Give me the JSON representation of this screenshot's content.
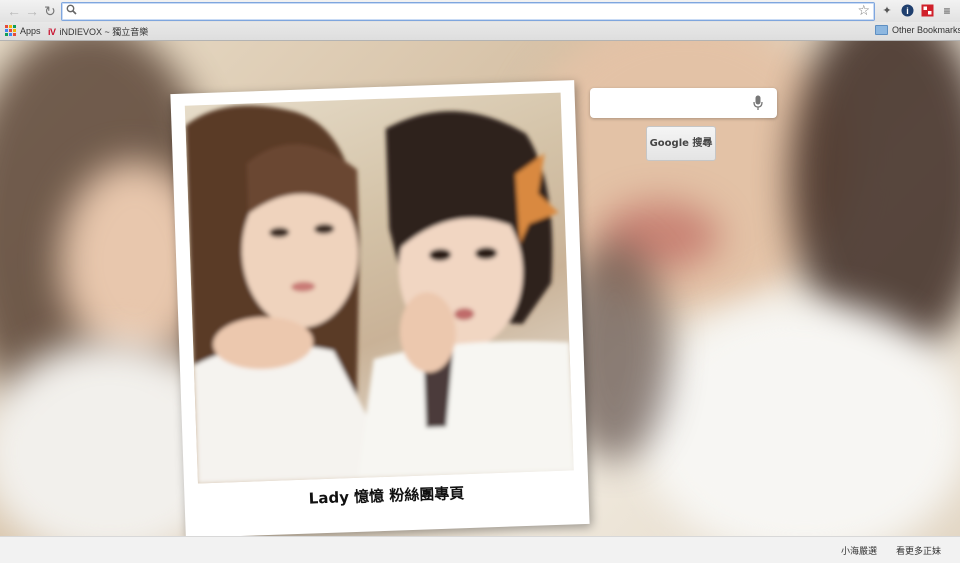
{
  "browser": {
    "address_value": "",
    "bookmarks": {
      "apps_label": "Apps",
      "indievox_label": "iNDIEVOX ~ 獨立音樂",
      "other_label": "Other Bookmarks"
    }
  },
  "page": {
    "caption": "Lady 憶憶 粉絲團專頁",
    "search": {
      "value": "",
      "button_label": "Google 搜尋"
    },
    "footer": {
      "link1": "小海嚴選",
      "link2": "看更多正妹"
    }
  },
  "colors": {
    "accent_focus": "#7fa6de",
    "bar_bg": "#f2f2f2",
    "indievox_red": "#c8102e"
  },
  "icons": [
    "back-icon",
    "forward-icon",
    "reload-icon",
    "search-icon",
    "star-icon",
    "extension-icon",
    "info-icon",
    "red-stamp-icon",
    "menu-icon",
    "apps-grid-icon",
    "folder-icon",
    "mic-icon"
  ]
}
